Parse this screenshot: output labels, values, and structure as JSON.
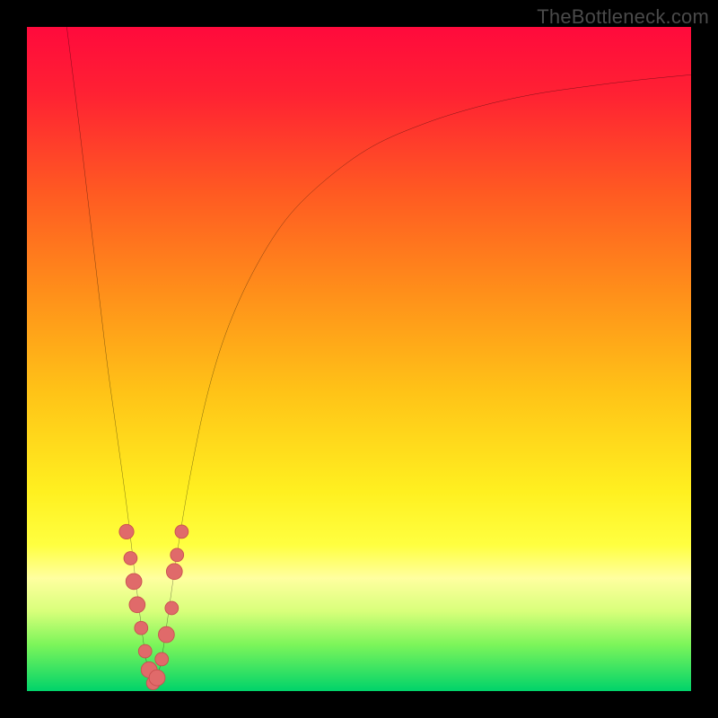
{
  "watermark": "TheBottleneck.com",
  "colors": {
    "black": "#000000",
    "curve": "#000000",
    "marker_fill": "#e06a6a",
    "marker_stroke": "#c94f4f",
    "gradient_stops": [
      {
        "offset": 0.0,
        "color": "#ff0a3c"
      },
      {
        "offset": 0.1,
        "color": "#ff2133"
      },
      {
        "offset": 0.25,
        "color": "#ff5a22"
      },
      {
        "offset": 0.4,
        "color": "#ff8f1a"
      },
      {
        "offset": 0.55,
        "color": "#ffc317"
      },
      {
        "offset": 0.7,
        "color": "#fff020"
      },
      {
        "offset": 0.78,
        "color": "#ffff40"
      },
      {
        "offset": 0.83,
        "color": "#ffffa0"
      },
      {
        "offset": 0.88,
        "color": "#d8ff7a"
      },
      {
        "offset": 0.93,
        "color": "#7cf55a"
      },
      {
        "offset": 1.0,
        "color": "#00d36a"
      }
    ]
  },
  "chart_data": {
    "type": "line",
    "title": "",
    "xlabel": "",
    "ylabel": "",
    "xlim": [
      0,
      100
    ],
    "ylim": [
      0,
      100
    ],
    "grid": false,
    "notes": "Black V-shaped bottleneck curve over red→green vertical gradient. Values are estimated from pixel positions; axes are unlabeled so units are percent of plot area (0 at bottom-left).",
    "series": [
      {
        "name": "bottleneck-curve",
        "x": [
          6.0,
          8.0,
          10.0,
          12.0,
          13.5,
          15.0,
          16.2,
          17.2,
          17.9,
          18.5,
          19.0,
          19.6,
          20.3,
          21.2,
          22.5,
          24.5,
          27.0,
          30.0,
          34.0,
          39.0,
          45.0,
          52.0,
          60.0,
          68.0,
          76.0,
          84.0,
          92.0,
          100.0
        ],
        "y": [
          100.0,
          84.0,
          67.0,
          50.0,
          39.0,
          28.0,
          18.0,
          10.0,
          5.0,
          2.0,
          0.5,
          2.0,
          5.0,
          11.0,
          20.0,
          32.0,
          44.0,
          54.0,
          63.0,
          71.0,
          77.0,
          82.0,
          85.5,
          88.0,
          89.8,
          91.0,
          92.0,
          92.8
        ]
      }
    ],
    "markers": {
      "name": "highlighted-points",
      "color": "#e06a6a",
      "points": [
        {
          "x": 15.0,
          "y": 24.0,
          "r": 1.1
        },
        {
          "x": 15.6,
          "y": 20.0,
          "r": 1.0
        },
        {
          "x": 16.1,
          "y": 16.5,
          "r": 1.2
        },
        {
          "x": 16.6,
          "y": 13.0,
          "r": 1.2
        },
        {
          "x": 17.2,
          "y": 9.5,
          "r": 1.0
        },
        {
          "x": 17.8,
          "y": 6.0,
          "r": 1.0
        },
        {
          "x": 18.4,
          "y": 3.2,
          "r": 1.2
        },
        {
          "x": 19.0,
          "y": 1.2,
          "r": 1.0
        },
        {
          "x": 19.6,
          "y": 2.0,
          "r": 1.2
        },
        {
          "x": 20.3,
          "y": 4.8,
          "r": 1.0
        },
        {
          "x": 21.0,
          "y": 8.5,
          "r": 1.2
        },
        {
          "x": 21.8,
          "y": 12.5,
          "r": 1.0
        },
        {
          "x": 22.2,
          "y": 18.0,
          "r": 1.2
        },
        {
          "x": 22.6,
          "y": 20.5,
          "r": 1.0
        },
        {
          "x": 23.3,
          "y": 24.0,
          "r": 1.0
        }
      ]
    }
  }
}
